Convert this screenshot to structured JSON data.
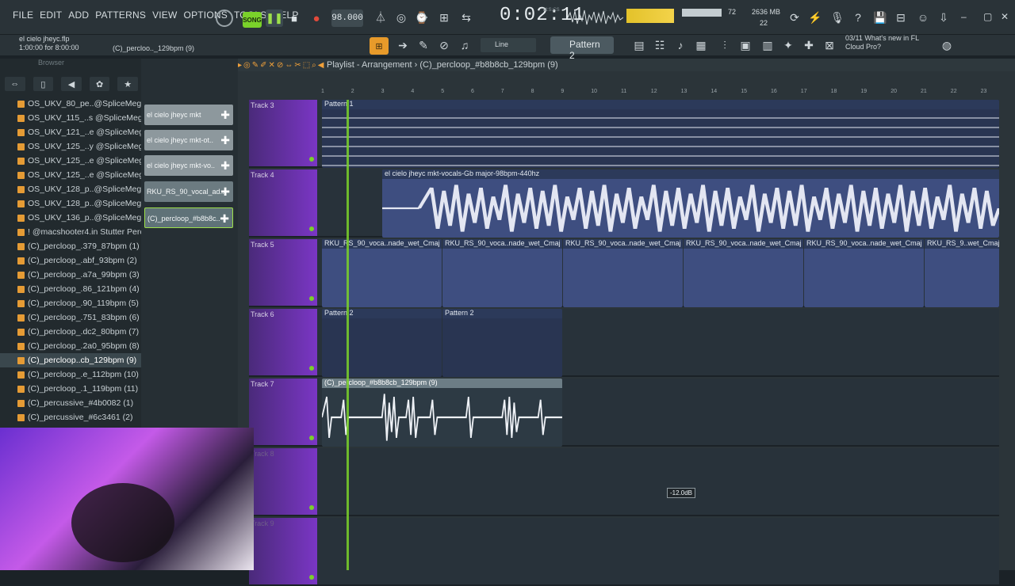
{
  "menu": [
    "FILE",
    "EDIT",
    "ADD",
    "PATTERNS",
    "VIEW",
    "OPTIONS",
    "TOOLS",
    "HELP"
  ],
  "transport": {
    "song_label": "SONG",
    "tempo": "98.000",
    "time": "0:02:11",
    "time_sub": "M:S:CS"
  },
  "monitor": {
    "cpu": "72",
    "mem": "2636 MB",
    "mem_voices": "22"
  },
  "project": {
    "file": "el cielo jheyc.flp",
    "progress": "1:00:00 for 8:00:00",
    "hint": "(C)_percloo.._129bpm (9)"
  },
  "toolbar2": {
    "snap_label": "Line",
    "pattern": "Pattern 2"
  },
  "news": {
    "date": "03/11",
    "title": "What's new in FL",
    "subtitle": "Cloud Pro?"
  },
  "browser": {
    "title": "Browser",
    "items": [
      "OS_UKV_80_pe..@SpliceMega",
      "OS_UKV_115_..s @SpliceMega",
      "OS_UKV_121_..e @SpliceMega",
      "OS_UKV_125_..y @SpliceMega",
      "OS_UKV_125_..e @SpliceMega",
      "OS_UKV_125_..e @SpliceMega",
      "OS_UKV_128_p..@SpliceMega",
      "OS_UKV_128_p..@SpliceMega",
      "OS_UKV_136_p..@SpliceMega",
      "! @macshooter4.in Stutter Perc",
      "(C)_percloop_.379_87bpm (1)",
      "(C)_percloop_.abf_93bpm (2)",
      "(C)_percloop_.a7a_99bpm (3)",
      "(C)_percloop_.86_121bpm (4)",
      "(C)_percloop_.90_119bpm (5)",
      "(C)_percloop_.751_83bpm (6)",
      "(C)_percloop_.dc2_80bpm (7)",
      "(C)_percloop_.2a0_95bpm (8)",
      "(C)_percloop..cb_129bpm (9)",
      "(C)_percloop_.e_112bpm (10)",
      "(C)_percloop_.1_119bpm (11)",
      "(C)_percussive_#4b0082 (1)",
      "(C)_percussive_#6c3461 (2)"
    ]
  },
  "picker": {
    "items": [
      "el cielo jheyc mkt",
      "el cielo jheyc mkt-ot..",
      "el cielo jheyc mkt-vo..",
      "RKU_RS_90_vocal_ad..",
      "(C)_percloop_#b8b8c.."
    ]
  },
  "playlist": {
    "title": "Playlist - Arrangement",
    "breadcrumb": "(C)_percloop_#b8b8cb_129bpm (9)",
    "tracks": [
      "Track 3",
      "Track 4",
      "Track 5",
      "Track 6",
      "Track 7",
      "Track 8",
      "Track 9"
    ],
    "clips": {
      "pattern1": "Pattern 1",
      "pattern2": "Pattern 2",
      "vocals": "el cielo jheyc mkt-vocals-Gb major-98bpm-440hz",
      "rku": "RKU_RS_90_voca..nade_wet_Cmaj",
      "rku_short": "RKU_RS_9..wet_Cmaj",
      "perc": "(C)_percloop_#b8b8cb_129bpm (9)"
    },
    "ruler": [
      "1",
      "2",
      "3",
      "4",
      "5",
      "6",
      "7",
      "8",
      "9",
      "10",
      "11",
      "12",
      "13",
      "14",
      "15",
      "16",
      "17",
      "18",
      "19",
      "20",
      "21",
      "22",
      "23"
    ],
    "cursor_value": "-12.0dB"
  },
  "colors": {
    "accent": "#7ad12a",
    "track_header": "#7a36c4",
    "clip_audio": "#3e4e80",
    "snap": "#e79a2a"
  }
}
